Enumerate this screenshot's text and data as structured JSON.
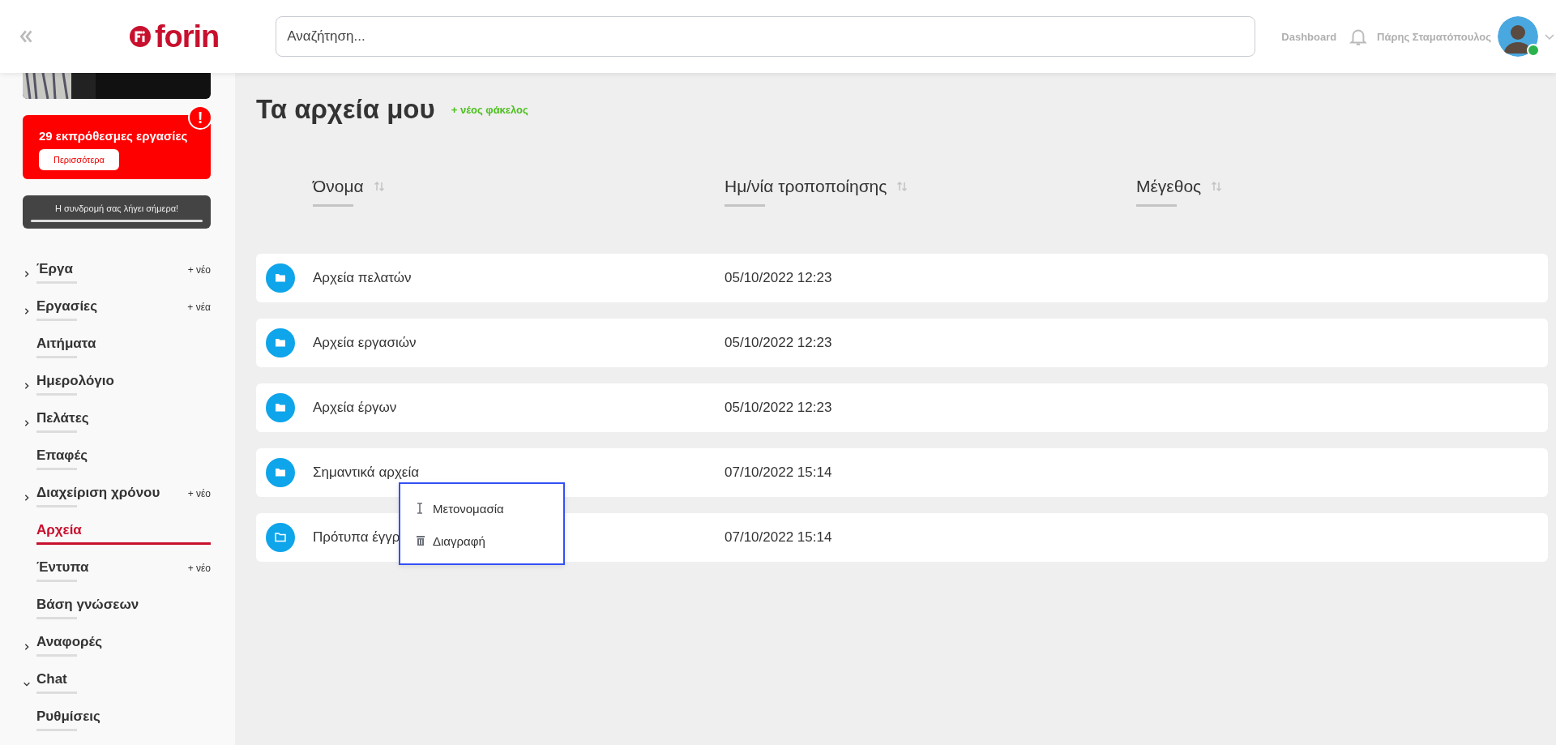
{
  "header": {
    "logo_text": "forin",
    "search": {
      "placeholder": "Αναζήτηση..."
    },
    "dashboard_link": "Dashboard",
    "user_name": "Πάρης Σταματόπουλος",
    "user_online": true
  },
  "sidebar": {
    "alert": {
      "text": "29 εκπρόθεσμες εργασίες",
      "button": "Περισσότερα",
      "badge": "!"
    },
    "subscription": {
      "text": "Η συνδρομή σας λήγει σήμερα!",
      "level": 1
    },
    "items": [
      {
        "label": "Έργα",
        "expanded": false,
        "selected": false,
        "action": "+ νέο"
      },
      {
        "label": "Εργασίες",
        "expanded": false,
        "selected": false,
        "action": "+ νέα"
      },
      {
        "label": "Αιτήματα",
        "selected": false
      },
      {
        "label": "Ημερολόγιο",
        "expanded": false,
        "selected": false
      },
      {
        "label": "Πελάτες",
        "expanded": false,
        "selected": false
      },
      {
        "label": "Επαφές",
        "selected": false
      },
      {
        "label": "Διαχείριση χρόνου",
        "expanded": false,
        "selected": false,
        "action": "+ νέο"
      },
      {
        "label": "Αρχεία",
        "selected": true
      },
      {
        "label": "Έντυπα",
        "selected": false,
        "action": "+ νέο"
      },
      {
        "label": "Βάση γνώσεων",
        "selected": false
      },
      {
        "label": "Αναφορές",
        "expanded": false,
        "selected": false
      },
      {
        "label": "Chat",
        "expanded": true,
        "selected": false
      },
      {
        "label": "Ρυθμίσεις",
        "selected": false
      }
    ]
  },
  "page": {
    "title": "Τα αρχεία μου",
    "new_folder": "+ νέος φάκελος"
  },
  "table": {
    "columns": [
      "Όνομα",
      "Ημ/νία τροποποίησης",
      "Μέγεθος"
    ],
    "rows": [
      {
        "kind": "filled",
        "name": "Αρχεία πελατών",
        "modified": "05/10/2022 12:23"
      },
      {
        "kind": "filled",
        "name": "Αρχεία εργασιών",
        "modified": "05/10/2022 12:23"
      },
      {
        "kind": "filled",
        "name": "Αρχεία έργων",
        "modified": "05/10/2022 12:23"
      },
      {
        "kind": "filled",
        "name": "Σημαντικά αρχεία",
        "modified": "07/10/2022 15:14"
      },
      {
        "kind": "outline",
        "name": "Πρότυπα έγγρ",
        "modified": "07/10/2022 15:14"
      }
    ]
  },
  "context_menu": {
    "items": [
      {
        "kind": "rename",
        "label": "Μετονομασία"
      },
      {
        "kind": "delete",
        "label": "Διαγραφή"
      }
    ]
  }
}
